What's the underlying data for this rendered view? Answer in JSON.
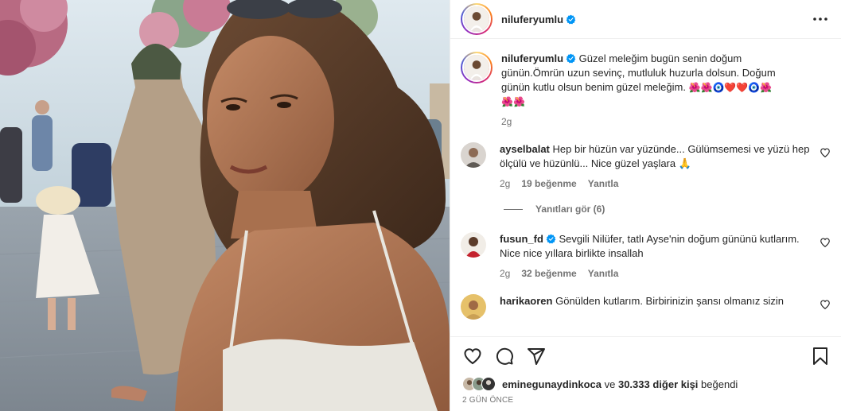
{
  "post": {
    "author": "niluferyumlu",
    "more_icon": "more-horizontal-icon"
  },
  "caption": {
    "username": "niluferyumlu",
    "text": "Güzel meleğim bugün senin doğum gününÖmrün uzun sevinç, mutluluk huzurla dolsun. Doğum günün kutlu olsun benim güzel meleğim.",
    "text_a": "Güzel meleğim bugün senin doğum",
    "text_b": "günün.Ömrün uzun sevinç, mutluluk huzurla dolsun. Doğum",
    "text_c": "günün kutlu olsun benim güzel meleğim.",
    "emojis_line1": "🌺🌺🧿❤️❤️🧿🌺",
    "emojis_line2": "🌺🌺",
    "age": "2g"
  },
  "comments": [
    {
      "username": "ayselbalat",
      "text": "Hep bir hüzün var yüzünde... Gülümsemesi ve yüzü hep ölçülü ve hüzünlü... Nice güzel yaşlara 🙏",
      "age": "2g",
      "likes": "19 beğenme",
      "reply": "Yanıtla"
    },
    {
      "username": "fusun_fd",
      "text": "Sevgili Nilüfer, tatlı Ayse'nin doğum gününü kutlarım. Nice nice yıllara birlikte insallah",
      "age": "2g",
      "likes": "32 beğenme",
      "reply": "Yanıtla"
    },
    {
      "username": "harikaoren",
      "text": "Gönülden kutlarım. Birbirinizin şansı olmanız sizin"
    }
  ],
  "view_replies": "Yanıtları gör (6)",
  "likes": {
    "first_user": "eminegunaydinkoca",
    "connector": "ve",
    "others": "30.333 diğer kişi",
    "suffix": "beğendi"
  },
  "date": "2 GÜN ÖNCE",
  "colors": {
    "verified_blue": "#0095f6",
    "text": "#262626",
    "muted": "#737373",
    "border": "#efefef"
  }
}
